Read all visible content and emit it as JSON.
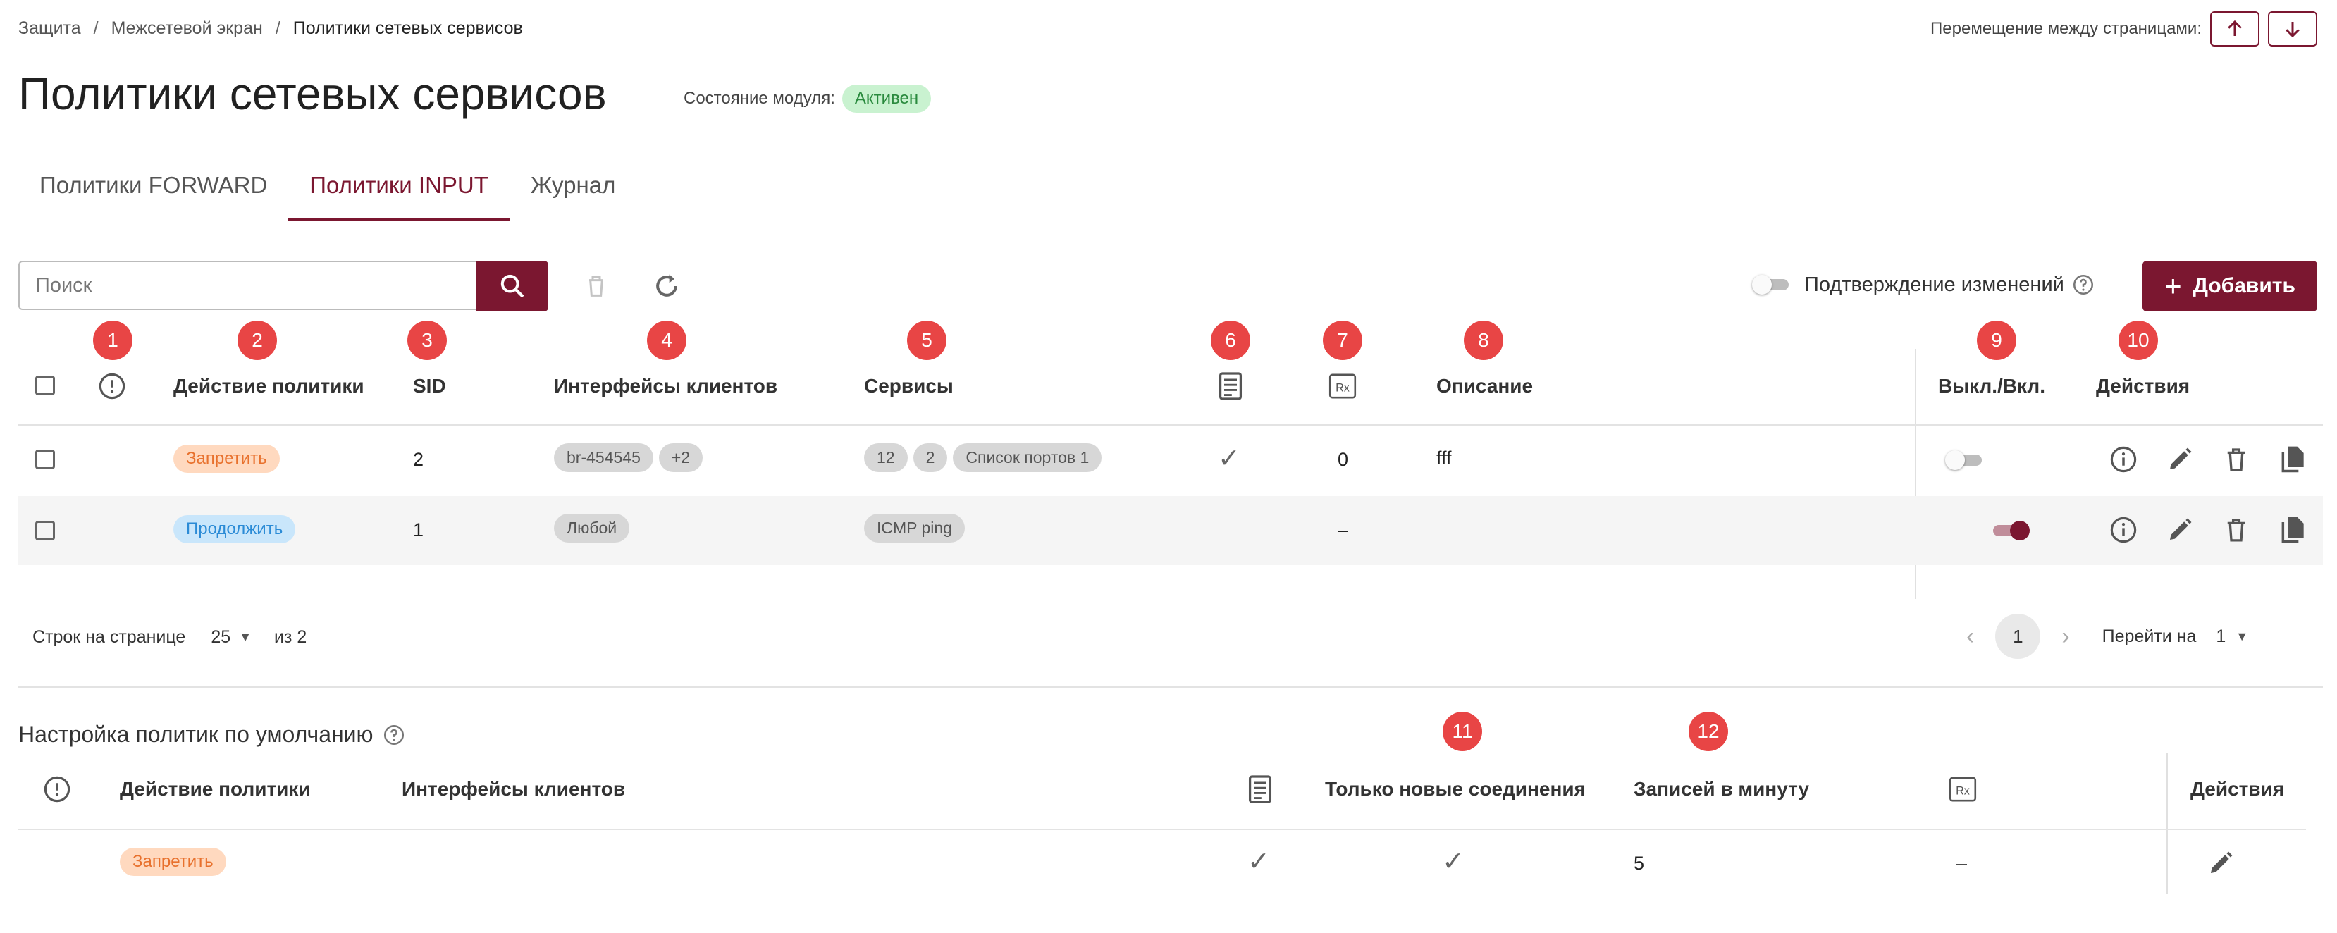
{
  "breadcrumb": {
    "items": [
      "Защита",
      "Межсетевой экран",
      "Политики сетевых сервисов"
    ],
    "separator": "/"
  },
  "page_nav": {
    "label": "Перемещение между страницами:",
    "up_icon": "arrow-up-icon",
    "down_icon": "arrow-down-icon"
  },
  "title": "Политики сетевых сервисов",
  "module_state": {
    "label": "Состояние модуля:",
    "value": "Активен"
  },
  "tabs": [
    {
      "label": "Политики FORWARD",
      "active": false
    },
    {
      "label": "Политики INPUT",
      "active": true
    },
    {
      "label": "Журнал",
      "active": false
    }
  ],
  "search": {
    "placeholder": "Поиск"
  },
  "confirm_changes": {
    "label": "Подтверждение изменений",
    "enabled": false
  },
  "add_button": {
    "label": "Добавить"
  },
  "markers": [
    "1",
    "2",
    "3",
    "4",
    "5",
    "6",
    "7",
    "8",
    "9",
    "10",
    "11",
    "12"
  ],
  "table": {
    "headers": {
      "action": "Действие политики",
      "sid": "SID",
      "interfaces": "Интерфейсы клиентов",
      "services": "Сервисы",
      "description": "Описание",
      "toggle": "Выкл./Вкл.",
      "actions": "Действия"
    },
    "rows": [
      {
        "action": "Запретить",
        "sid": "2",
        "interfaces": [
          "br-454545",
          "+2"
        ],
        "services": [
          "12",
          "2",
          "Список портов 1"
        ],
        "log": "✓",
        "rx": "0",
        "description": "fff",
        "enabled": false
      },
      {
        "action": "Продолжить",
        "sid": "1",
        "interfaces": [
          "Любой"
        ],
        "services": [
          "ICMP ping"
        ],
        "log": "",
        "rx": "–",
        "description": "",
        "enabled": true
      }
    ]
  },
  "pagination": {
    "rows_label": "Строк на странице",
    "rows_value": "25",
    "of_label": "из 2",
    "current_page": "1",
    "goto_label": "Перейти на",
    "goto_value": "1"
  },
  "defaults": {
    "title": "Настройка политик по умолчанию",
    "headers": {
      "action": "Действие политики",
      "interfaces": "Интерфейсы клиентов",
      "new_only": "Только новые соединения",
      "per_minute": "Записей в минуту",
      "actions": "Действия"
    },
    "row": {
      "action": "Запретить",
      "log": "✓",
      "new_only": "✓",
      "per_minute": "5",
      "rx": "–"
    }
  },
  "colors": {
    "accent": "#7b1730",
    "marker": "#e84545",
    "active_badge_bg": "#c9f2d0",
    "deny_badge_bg": "#ffd9bf",
    "continue_badge_bg": "#c9e6fb"
  }
}
